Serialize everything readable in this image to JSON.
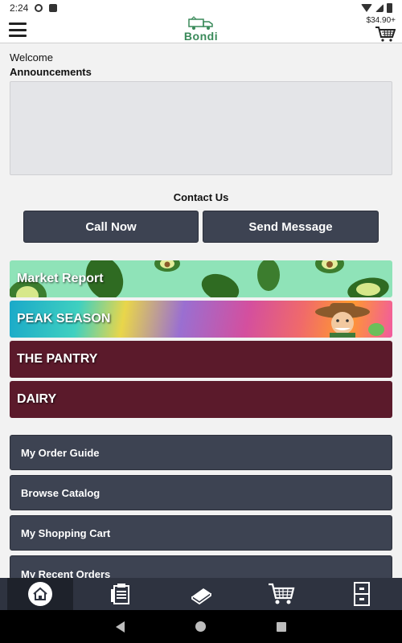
{
  "status_bar": {
    "time": "2:24",
    "icons": [
      "gear-icon",
      "sd-card-icon",
      "wifi-icon",
      "signal-icon",
      "battery-icon"
    ]
  },
  "header": {
    "logo_text": "Bondi",
    "cart_total": "$34.90+",
    "icons": [
      "hamburger-menu-icon",
      "truck-logo-icon",
      "cart-icon"
    ]
  },
  "welcome": {
    "label": "Welcome"
  },
  "announcements": {
    "label": "Announcements"
  },
  "contact": {
    "label": "Contact Us",
    "call_label": "Call Now",
    "message_label": "Send Message"
  },
  "promos": [
    {
      "label": "Market Report",
      "color": "#8fe3b8"
    },
    {
      "label": "PEAK SEASON",
      "color": "#d44f9e"
    },
    {
      "label": "THE PANTRY",
      "color": "#5b1a2b"
    },
    {
      "label": "DAIRY",
      "color": "#5b1a2b"
    }
  ],
  "menu": [
    {
      "label": "My Order Guide"
    },
    {
      "label": "Browse Catalog"
    },
    {
      "label": "My Shopping Cart"
    },
    {
      "label": "My Recent Orders"
    }
  ],
  "bottom_nav": {
    "items": [
      "home-icon",
      "order-guide-icon",
      "catalog-icon",
      "cart-icon",
      "orders-icon"
    ],
    "active": "home-icon"
  },
  "colors": {
    "primary_dark": "#3d4352",
    "nav_bg": "#2e3340",
    "promo_maroon": "#5b1a2b",
    "logo_green": "#3a8a5a"
  }
}
